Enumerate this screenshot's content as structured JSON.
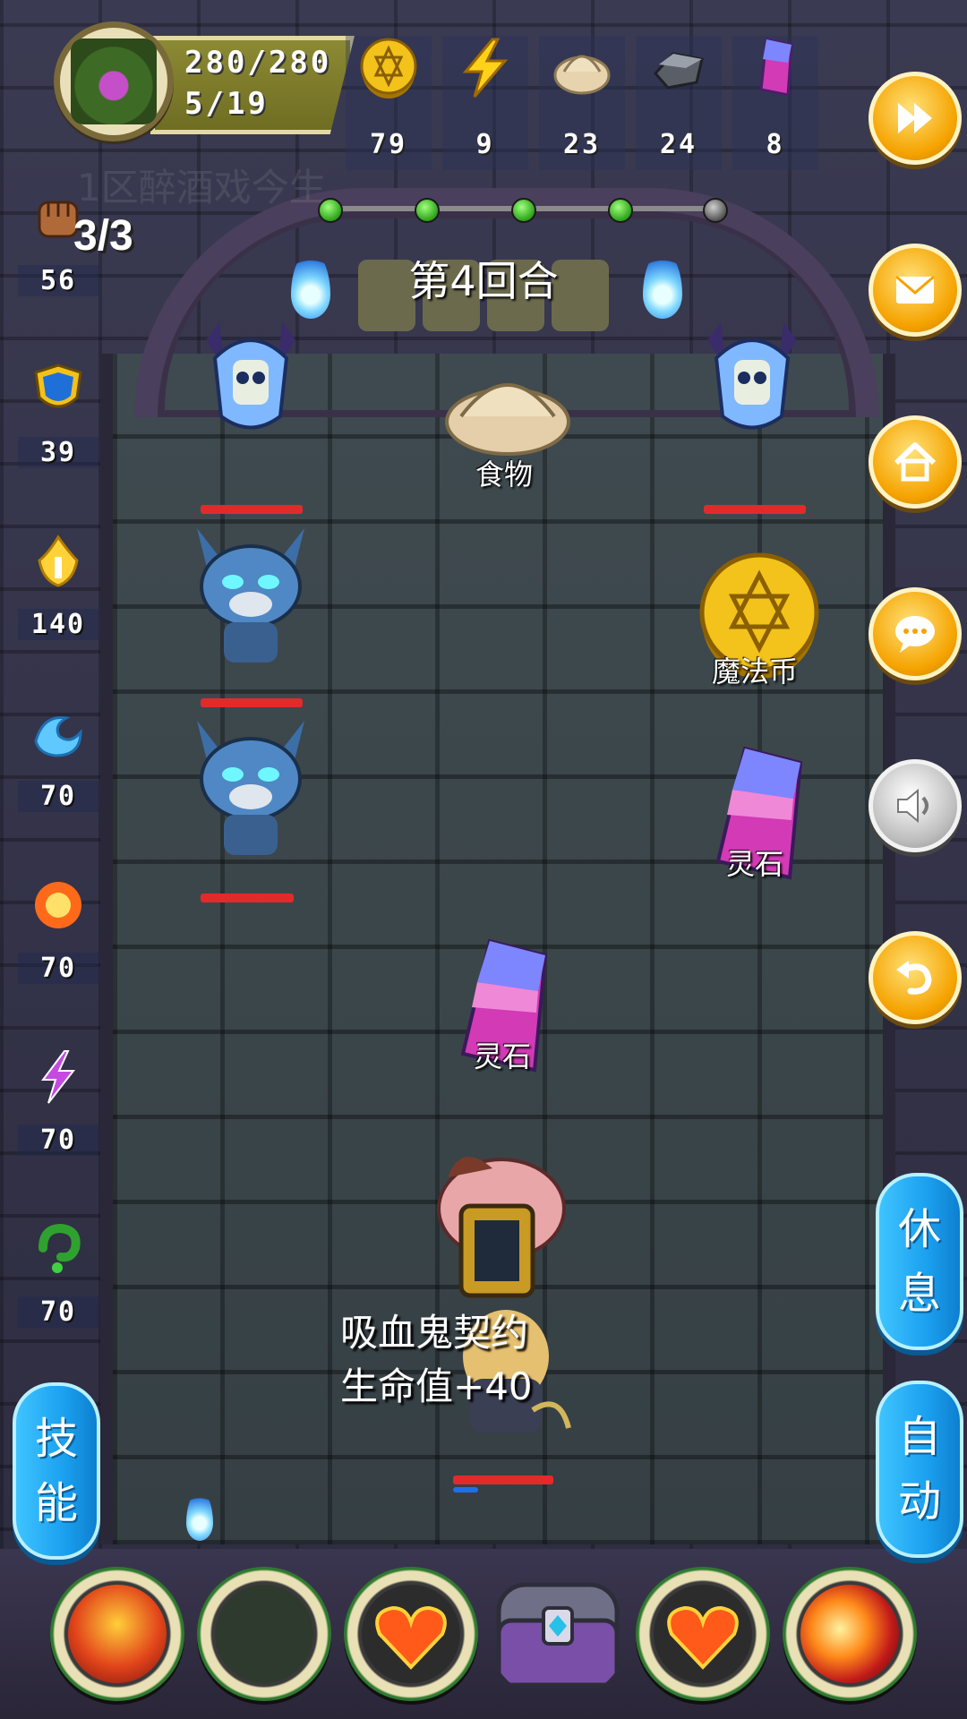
{
  "hud": {
    "hp": "280/280",
    "level": "5/19",
    "resources": [
      {
        "name": "gold-coin-icon",
        "value": "79"
      },
      {
        "name": "energy-bolt-icon",
        "value": "9"
      },
      {
        "name": "dumpling-food-icon",
        "value": "23"
      },
      {
        "name": "iron-ore-icon",
        "value": "24"
      },
      {
        "name": "spirit-gem-icon",
        "value": "8"
      }
    ],
    "player_name": "1区醉酒戏今生",
    "attack_count": "3/3",
    "round_label": "第4回合",
    "round_progress": {
      "total": 5,
      "completed": 4
    }
  },
  "stats": [
    {
      "icon": "fist-icon",
      "value": "56"
    },
    {
      "icon": "shield-icon",
      "value": "39"
    },
    {
      "icon": "holy-flame-icon",
      "value": "140"
    },
    {
      "icon": "water-wave-icon",
      "value": "70"
    },
    {
      "icon": "fire-burst-icon",
      "value": "70"
    },
    {
      "icon": "lightning-icon",
      "value": "70"
    },
    {
      "icon": "poison-icon",
      "value": "70"
    }
  ],
  "side_buttons": {
    "fast_forward": "fast-forward-icon",
    "mail": "mail-icon",
    "home": "home-icon",
    "chat": "chat-icon",
    "sound": "sound-icon",
    "back": "back-icon",
    "rest_1": "休",
    "rest_2": "息",
    "auto_1": "自",
    "auto_2": "动",
    "skill_1": "技",
    "skill_2": "能"
  },
  "board": {
    "items": {
      "food": "食物",
      "coin": "魔法币",
      "gem_right": "灵石",
      "gem_center": "灵石"
    },
    "popup_line1": "吸血鬼契约",
    "popup_line2": "生命值+40"
  },
  "skillbar": [
    {
      "icon": "hellfire-demon-skill-icon"
    },
    {
      "icon": "empty-slot"
    },
    {
      "icon": "flaming-heart-skill-icon"
    },
    {
      "icon": "treasure-chest-icon"
    },
    {
      "icon": "flaming-heart-skill-icon"
    },
    {
      "icon": "fire-slash-skill-icon"
    }
  ],
  "colors": {
    "gold_button": "#f5a300",
    "blue_pill": "#1aa0ef",
    "hp_bar": "#e32a2a"
  }
}
